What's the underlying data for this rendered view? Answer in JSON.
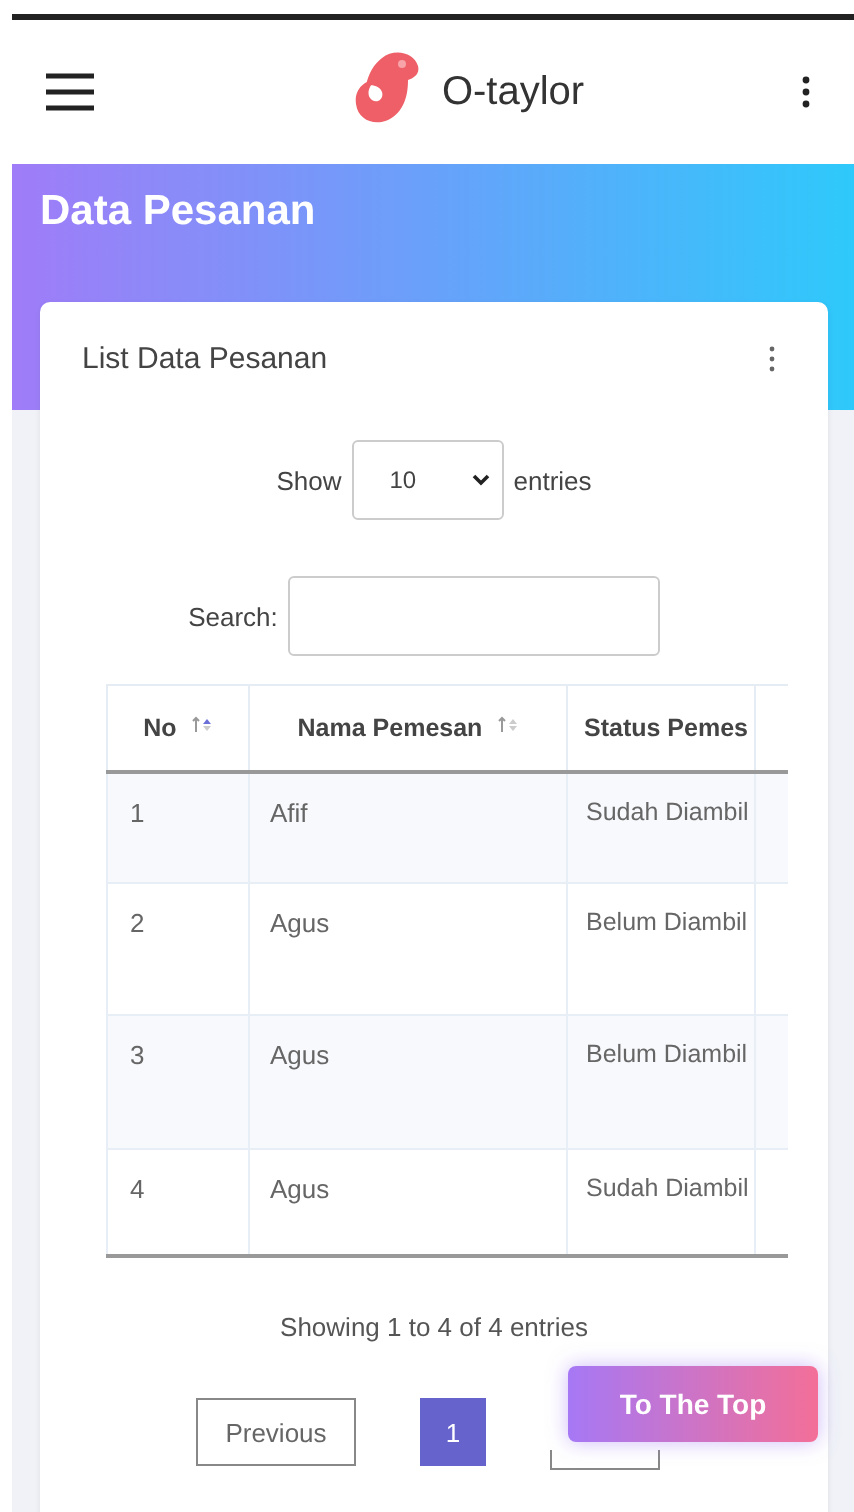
{
  "app_bar": {
    "brand": "O-taylor"
  },
  "page_title": "Data Pesanan",
  "card": {
    "title": "List Data Pesanan",
    "length": {
      "label_before": "Show",
      "value": "10",
      "label_after": "entries"
    },
    "search": {
      "label": "Search:"
    },
    "table": {
      "columns": [
        {
          "label": "No",
          "sortable": true,
          "sorted": true
        },
        {
          "label": "Nama Pemesan",
          "sortable": true,
          "sorted": false
        },
        {
          "label": "Status Pemes"
        }
      ],
      "rows": [
        [
          "1",
          "Afif",
          "Sudah Diambil"
        ],
        [
          "2",
          "Agus",
          "Belum Diambil"
        ],
        [
          "3",
          "Agus",
          "Belum Diambil"
        ],
        [
          "4",
          "Agus",
          "Sudah Diambil"
        ]
      ]
    },
    "info": "Showing 1 to 4 of 4 entries",
    "pagination": {
      "previous": "Previous",
      "pages": [
        {
          "label": "1",
          "selected": true
        }
      ]
    }
  },
  "to_top": "To The Top"
}
